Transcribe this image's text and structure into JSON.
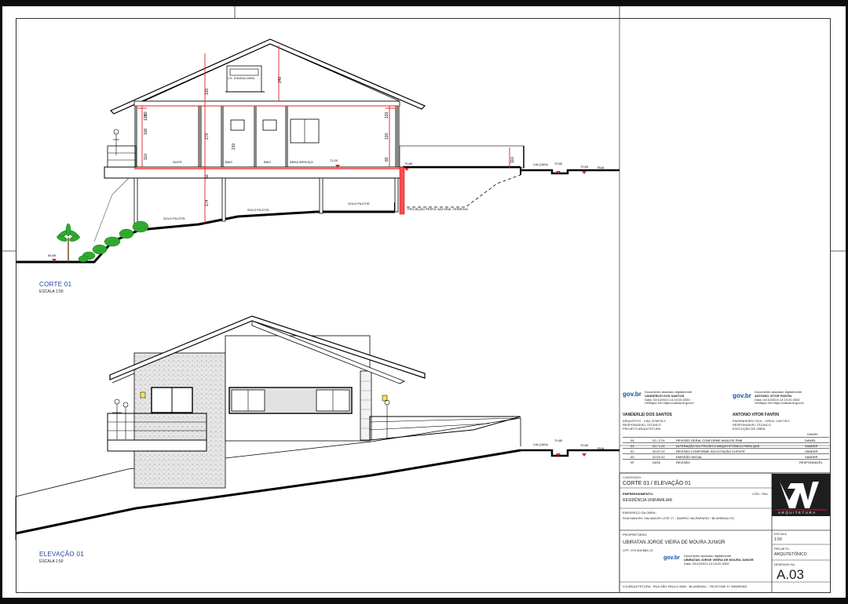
{
  "section_top": {
    "title": "CORTE 01",
    "scale": "ESCALA   1:50",
    "rooms": [
      "SUITE",
      "BWC",
      "BWC",
      "ÁREA SERVIÇO"
    ],
    "labels": {
      "solo_pilotis": "SOLO PILOTIS",
      "projecao": "PROJEÇÃO PERFIL NATURAL TERRENO",
      "calcada": "CALÇADA",
      "rua": "RUA",
      "caixa": "CX. D'ÁGUA 1000L",
      "lvl_floor": "71,00",
      "lvl_calc": "70,85",
      "lvl_rua": "70,55",
      "lvl_ground": "64,85"
    },
    "dims": [
      "120",
      "240",
      "80",
      "100",
      "270",
      "210",
      "120",
      "80",
      "110",
      "50",
      "174",
      "110"
    ]
  },
  "section_bottom": {
    "title": "ELEVAÇÃO 01",
    "scale": "ESCALA   1:50",
    "labels": {
      "calcada": "CALÇADA",
      "rua": "RUA",
      "lvl_calc": "70,85",
      "lvl_rua": "70,55"
    }
  },
  "title_block": {
    "logo_word": "gov.br",
    "sign_small": "Documento assinado digitalmente",
    "sign_tiny_1": "Data: 02/10/2024 14:15:20-0300",
    "sign_tiny_2": "Verifique em https://validar.iti.gov.br",
    "person1": {
      "name": "VANDERLEI DOS SANTOS",
      "role1": "ARQUITETO - CAU: A76576-9",
      "role2": "RESPONSÁVEL TÉCNICO",
      "role3": "PROJETO ARQUITETURA"
    },
    "person2": {
      "name": "ANTONIO VITOR FANTIN",
      "role1": "ENGENHEIRO CIVIL - CREA / 106778-0",
      "role2": "RESPONSÁVEL TÉCNICO",
      "role3": "EXECUÇÃO DE OBRA"
    },
    "revisions_header": {
      "no": "Nº",
      "date": "DATA",
      "rev": "REVISÃO",
      "resp": "RESPONSÁVEL"
    },
    "revisions_top": "DANIEL",
    "revisions": [
      {
        "no": "04",
        "date": "02 / 2.24",
        "desc": "REVISÃO GERAL CONFORME ANÁLISE PMB",
        "resp": "DANIEL"
      },
      {
        "no": "03",
        "date": "20 / 1.24",
        "desc": "ALTERAÇÃO DO PROJETO ARQUITETÔNICO PARA QDE",
        "resp": "VANDER"
      },
      {
        "no": "01",
        "date": "20.07.22",
        "desc": "REVISÃO CONFORME SOLICITAÇÃO CLIENTE",
        "resp": "VANDER"
      },
      {
        "no": "00",
        "date": "20.03.22",
        "desc": "EMISSÃO INICIAL",
        "resp": "VANDER"
      }
    ],
    "conteudo_label": "CONTEÚDO:",
    "conteudo": "CORTE 01 / ELEVAÇÃO 01",
    "empreendimento_label": "EMPREENDIMENTO:",
    "empreendimento": "RESIDÊNCIA UNIFAMILIAR",
    "endereco_label": "ENDEREÇO DA OBRA:",
    "endereco": "RUA MANOEL SALVADOR LOTE 17 - BAIRRO VALPARAÍSO / BLUMENAU SC",
    "proprietario_label": "PROPRIETÁRIO:",
    "proprietario": "UBIRATAN JORGE VIEIRA DE MOURA JUNIOR",
    "cpf": "CPF: 079.308.889-13",
    "escala_label": "ESCALA",
    "escala": "1:50",
    "projeto_label": "PROJETO",
    "projeto": "ARQUITETÔNICO",
    "desenho_label": "DESENHO No.",
    "desenho": "A.03",
    "brand_letters": "VA",
    "brand_word": "ARQUITETURA",
    "codigo_label": "CÓD.: PAU",
    "footer": "V.A ARQUITETURA - RUA SÃO PAULO 2860 - BLUMENAU - TELEFONE 47 996695363"
  }
}
